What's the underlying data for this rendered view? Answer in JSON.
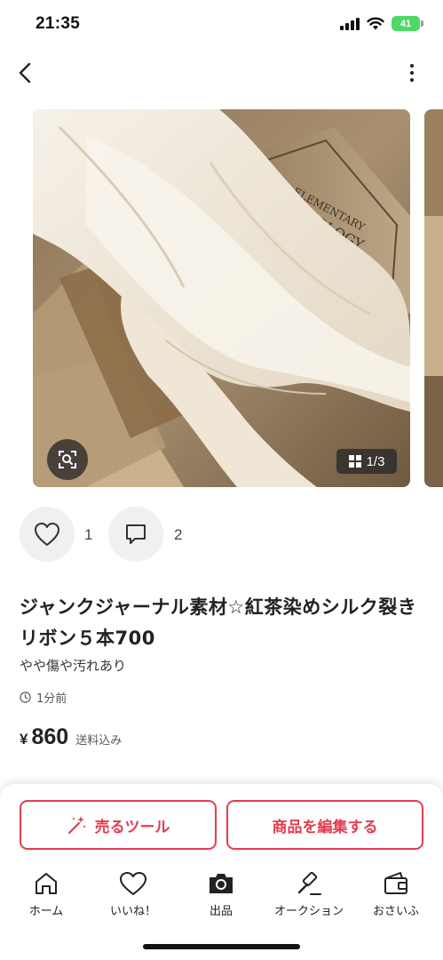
{
  "status_bar": {
    "time": "21:35",
    "battery": "41"
  },
  "header": {
    "back_icon": "chevron-left-icon",
    "more_icon": "more-vertical-icon"
  },
  "gallery": {
    "page_indicator": "1/3",
    "current_page": 1,
    "total_pages": 3,
    "lens_icon": "image-search-icon"
  },
  "reactions": {
    "likes": "1",
    "comments": "2"
  },
  "item": {
    "title": "ジャンクジャーナル素材☆紅茶染めシルク裂きリボン５本700",
    "condition": "やや傷や汚れあり",
    "posted": "1分前",
    "price_symbol": "¥",
    "price": "860",
    "shipping_note": "送料込み"
  },
  "actions": {
    "sell_tool": "売るツール",
    "edit_item": "商品を編集する"
  },
  "tabs": [
    {
      "label": "ホーム",
      "icon": "home-icon"
    },
    {
      "label": "いいね！",
      "icon": "heart-icon"
    },
    {
      "label": "出品",
      "icon": "camera-icon"
    },
    {
      "label": "オークション",
      "icon": "gavel-icon"
    },
    {
      "label": "おさいふ",
      "icon": "wallet-icon"
    }
  ],
  "colors": {
    "accent": "#e23d4f",
    "battery": "#4cd964"
  }
}
